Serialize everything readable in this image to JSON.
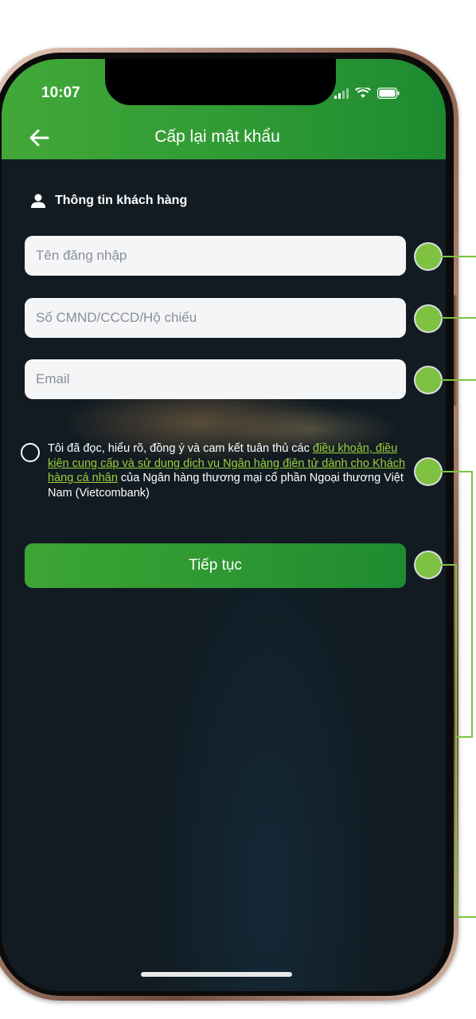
{
  "status_bar": {
    "time": "10:07"
  },
  "header": {
    "title": "Cấp lại mật khẩu"
  },
  "section": {
    "label": "Thông tin khách hàng"
  },
  "form": {
    "username_placeholder": "Tên đăng nhập",
    "id_placeholder": "Số CMND/CCCD/Hộ chiếu",
    "email_placeholder": "Email"
  },
  "terms": {
    "prefix": "Tôi đã đọc, hiểu rõ, đồng ý và cam kết tuân thủ các",
    "link": "điều khoản, điều kiện cung cấp và sử dụng dịch vụ Ngân hàng điện tử dành cho Khách hàng cá nhân",
    "suffix": "của Ngân hàng thương mại cổ phần Ngoại thương Việt Nam (Vietcombank)"
  },
  "actions": {
    "continue_label": "Tiếp tục"
  },
  "icons": {
    "back": "arrow-left-icon",
    "user": "user-icon",
    "signal": "signal-icon",
    "wifi": "wifi-icon",
    "battery": "battery-icon"
  },
  "colors": {
    "header_green": "#3aa336",
    "annotation_green": "#7fc242",
    "link_green": "#9ccf3a",
    "screen_bg": "#121b22"
  }
}
